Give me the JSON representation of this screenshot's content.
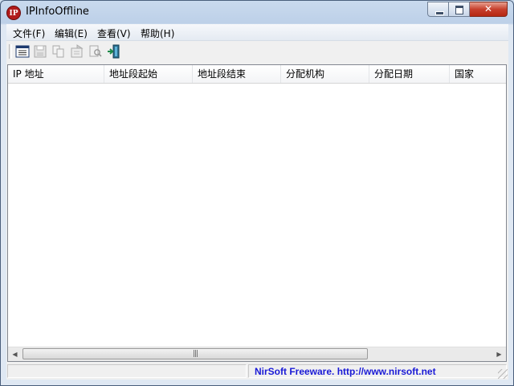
{
  "window": {
    "title": "IPInfoOffline",
    "icon_text": "IP"
  },
  "menu": [
    "文件(F)",
    "编辑(E)",
    "查看(V)",
    "帮助(H)"
  ],
  "toolbar": [
    {
      "name": "properties-icon",
      "enabled": true
    },
    {
      "name": "save-icon",
      "enabled": false
    },
    {
      "name": "copy-icon",
      "enabled": false
    },
    {
      "name": "html-report-icon",
      "enabled": false
    },
    {
      "name": "find-icon",
      "enabled": false
    },
    {
      "name": "exit-icon",
      "enabled": true
    }
  ],
  "columns": [
    "IP 地址",
    "地址段起始",
    "地址段结束",
    "分配机构",
    "分配日期",
    "国家"
  ],
  "rows": [],
  "status": {
    "text": "NirSoft Freeware.  http://www.nirsoft.net",
    "link_color": "#1a1ad6"
  },
  "colors": {
    "title_bar": "#c9daee",
    "close_button": "#c7402d"
  }
}
